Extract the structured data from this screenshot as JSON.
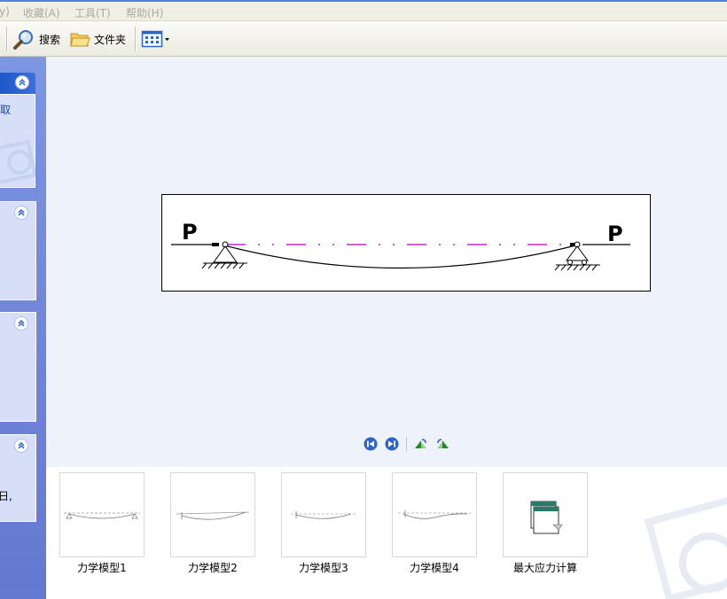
{
  "menubar": {
    "items": [
      {
        "label": "y)"
      },
      {
        "label": "收藏(A)"
      },
      {
        "label": "工具(T)"
      },
      {
        "label": "帮助(H)"
      }
    ]
  },
  "toolbar": {
    "search_label": "搜索",
    "folders_label": "文件夹"
  },
  "sidebar": {
    "panel1_text": "取",
    "panel4_text": "日,"
  },
  "viewer": {
    "label_left": "P",
    "label_right": "P"
  },
  "filmstrip": {
    "items": [
      {
        "label": "力学模型1"
      },
      {
        "label": "力学模型2"
      },
      {
        "label": "力学模型3"
      },
      {
        "label": "力学模型4"
      },
      {
        "label": "最大应力计算"
      }
    ]
  },
  "icons": {
    "search": "magnifier-icon",
    "folders": "folder-icon",
    "views": "views-icon",
    "prev": "previous-image-icon",
    "next": "next-image-icon",
    "rotate_cw": "rotate-clockwise-icon",
    "rotate_ccw": "rotate-counterclockwise-icon"
  },
  "colors": {
    "accent_blue": "#2c64c8",
    "sidebar_blue": "#6f82d8",
    "dash_magenta": "#b000b0"
  }
}
